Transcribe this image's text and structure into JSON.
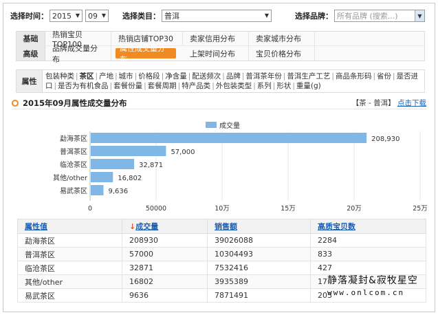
{
  "filters": {
    "time_label": "选择时间：",
    "year": "2015",
    "month": "09",
    "category_label": "选择类目：",
    "category": "普洱",
    "brand_label": "选择品牌：",
    "brand_placeholder": "所有品牌 (搜索...)"
  },
  "nav": {
    "rows": [
      {
        "head": "基础",
        "items": [
          "热销宝贝TOP100",
          "热销店铺TOP30",
          "卖家信用分布",
          "卖家城市分布"
        ]
      },
      {
        "head": "高级",
        "items": [
          "品牌成交量分布",
          "属性成交量分布",
          "上架时间分布",
          "宝贝价格分布"
        ]
      }
    ],
    "active": "属性成交量分布"
  },
  "attrs": {
    "head": "属性",
    "items": [
      "包装种类",
      "茶区",
      "产地",
      "城市",
      "价格段",
      "净含量",
      "配送频次",
      "品牌",
      "普洱茶年份",
      "普洱生产工艺",
      "商品条形码",
      "省份",
      "是否进口",
      "是否为有机食品",
      "套餐份量",
      "套餐周期",
      "特产品类",
      "外包装类型",
      "系列",
      "形状",
      "重量(g)"
    ],
    "selected": "茶区"
  },
  "section": {
    "title": "2015年09月属性成交量分布",
    "crumb": "【茶 - 普洱】",
    "download": "点击下载"
  },
  "chart_data": {
    "type": "bar",
    "orientation": "horizontal",
    "legend": "成交量",
    "legend_position": "top-center",
    "categories": [
      "勐海茶区",
      "普洱茶区",
      "临沧茶区",
      "其他/other",
      "易武茶区"
    ],
    "values": [
      208930,
      57000,
      32871,
      16802,
      9636
    ],
    "value_labels": [
      "208,930",
      "57,000",
      "32,871",
      "16,802",
      "9,636"
    ],
    "xlim": [
      0,
      250000
    ],
    "xticks": [
      0,
      50000,
      100000,
      150000,
      200000,
      250000
    ],
    "xtick_labels": [
      "0",
      "50000",
      "10万",
      "15万",
      "20万",
      "25万"
    ],
    "bar_color": "#7fb8e6",
    "grid": true
  },
  "table": {
    "headers": [
      "属性值",
      "成交量",
      "销售额",
      "高质宝贝数"
    ],
    "rows": [
      [
        "勐海茶区",
        "208930",
        "39026088",
        "2284"
      ],
      [
        "普洱茶区",
        "57000",
        "10304493",
        "833"
      ],
      [
        "临沧茶区",
        "32871",
        "7532416",
        "427"
      ],
      [
        "其他/other",
        "16802",
        "3935389",
        "17"
      ],
      [
        "易武茶区",
        "9636",
        "7871491",
        "203"
      ]
    ]
  },
  "watermark": {
    "line1": "静落凝封&寂牧星空",
    "line2": "www.onlcom.cn"
  },
  "colors": {
    "accent": "#f08a23",
    "link": "#1a5fb4",
    "bar": "#7fb8e6"
  }
}
